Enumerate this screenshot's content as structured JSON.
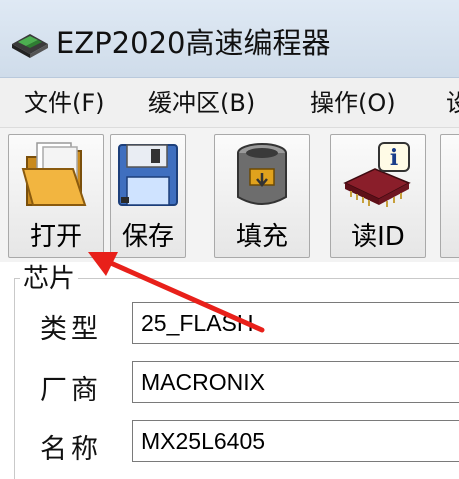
{
  "window": {
    "title": "EZP2020高速编程器",
    "icon": "programmer-chip-icon"
  },
  "menu": {
    "items": [
      "文件(F)",
      "缓冲区(B)",
      "操作(O)",
      "设"
    ]
  },
  "toolbar": {
    "buttons": [
      {
        "label": "打开",
        "icon": "open-folder-icon"
      },
      {
        "label": "保存",
        "icon": "floppy-save-icon"
      },
      {
        "label": "填充",
        "icon": "fill-bucket-icon"
      },
      {
        "label": "读ID",
        "icon": "chip-info-icon"
      }
    ]
  },
  "chip": {
    "group_title": "芯片",
    "type_label": "类型",
    "type_value": "25_FLASH",
    "vendor_label": "厂商",
    "vendor_value": "MACRONIX",
    "name_label": "名称",
    "name_value": "MX25L6405"
  },
  "annotation": {
    "arrow_color": "#e8201a"
  }
}
